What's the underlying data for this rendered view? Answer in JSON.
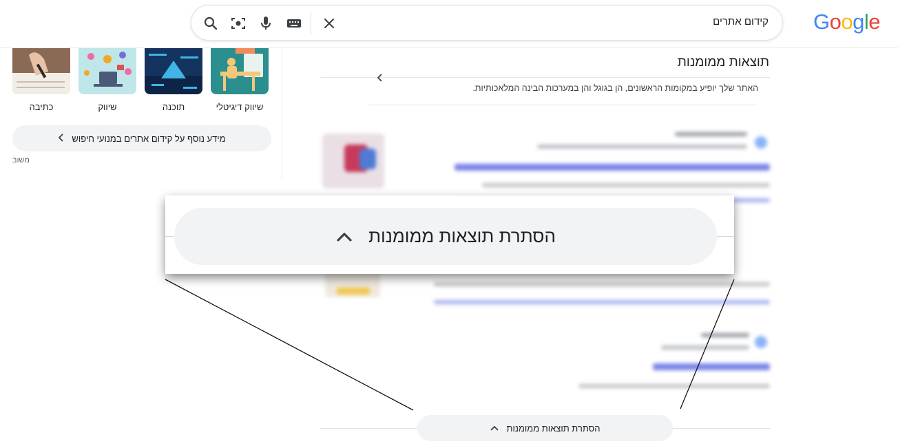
{
  "header": {
    "logo": [
      "G",
      "o",
      "o",
      "g",
      "l",
      "e"
    ],
    "logo_colors": [
      "#4285F4",
      "#EA4335",
      "#FBBC05",
      "#4285F4",
      "#34A853",
      "#EA4335"
    ],
    "search_query": "קידום אתרים",
    "icons": [
      "search-icon",
      "lens-icon",
      "mic-icon",
      "keyboard-icon",
      "clear-icon"
    ]
  },
  "left_panel": {
    "categories": [
      {
        "label": "שיווק דיגיטלי",
        "color": "#2b8f8f"
      },
      {
        "label": "תוכנה",
        "color": "#14335e"
      },
      {
        "label": "שיווק",
        "color": "#bfe6e8"
      },
      {
        "label": "כתיבה",
        "color": "#8b6a55"
      }
    ],
    "more_info_label": "מידע נוסף על קידום אתרים במנועי חיפוש",
    "feedback_label": "משוב"
  },
  "ai_overview": {
    "title": "תוצאות ממומנות",
    "snippet": "האתר שלך יופיע במקומות הראשונים, הן בגוגל והן במערכות הבינה המלאכותיות."
  },
  "hide_sponsored": {
    "label": "הסתרת תוצאות ממומנות"
  },
  "zoom": {
    "label": "הסתרת תוצאות ממומנות"
  },
  "colors": {
    "pill_bg": "#f1f3f4",
    "link_blue": "#1a0dab"
  }
}
